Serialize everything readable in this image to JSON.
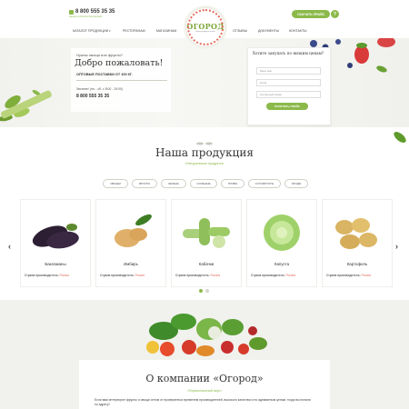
{
  "header": {
    "phone": "8 800 555 35 35",
    "phone_sub": "звонок по России бесплатный",
    "logo_title": "ОГОРОД",
    "logo_sub": "овощи и фрукты оптом",
    "price_button": "СКАЧАТЬ ПРАЙС",
    "help_button": "?",
    "nav": [
      "КАТАЛОГ ПРОДУКЦИИ",
      "РЕСТОРАНАМ",
      "МАГАЗИНАМ",
      "ОТЗЫВЫ",
      "ДОКУМЕНТЫ",
      "КОНТАКТЫ"
    ]
  },
  "hero": {
    "question": "Нужны овощи или фрукты?",
    "title": "Добро пожаловать!",
    "bulk": "ОПТОВЫЕ ПОСТАВКИ ОТ 100 КГ.",
    "call": "Звоните! (пн. - сб. с 8:00 - 19:00)",
    "phone": "8 800 555 35 35"
  },
  "form": {
    "title": "Хотите закупать по низким ценам?",
    "name_placeholder": "Ваше имя",
    "email_placeholder": "Email",
    "phone_placeholder": "Контактный номер",
    "submit": "ПОЛУЧИТЬ ПРАЙС"
  },
  "products": {
    "title": "Наша продукция",
    "subtitle": "«Натуральные продукты»",
    "tags": [
      "ОВОЩИ",
      "ФРУКТЫ",
      "ЗЕЛЕНЬ",
      "СОЛЕНЫЕ",
      "ГРИБЫ",
      "СУХОФРУКТЫ",
      "ЯГОДЫ"
    ],
    "country_label": "Страна производитель:",
    "items": [
      {
        "name": "Баклажаны",
        "country": "Россия"
      },
      {
        "name": "Имбирь",
        "country": "Россия"
      },
      {
        "name": "Кабачки",
        "country": "Россия"
      },
      {
        "name": "Капуста",
        "country": "Россия"
      },
      {
        "name": "Картофель",
        "country": "Россия"
      }
    ],
    "prev_arrow": "‹",
    "next_arrow": "›"
  },
  "about": {
    "title": "О компании «Огород»",
    "subtitle": "«Первоклассный вкус»",
    "text": "Если вам интересуют фрукты и овощи оптом от проверенных временем производителей, высокого качества и по адекватным ценам, тогда вы попали по адресу!"
  },
  "colors": {
    "accent": "#8bb94a",
    "highlight": "#e36b5a"
  }
}
